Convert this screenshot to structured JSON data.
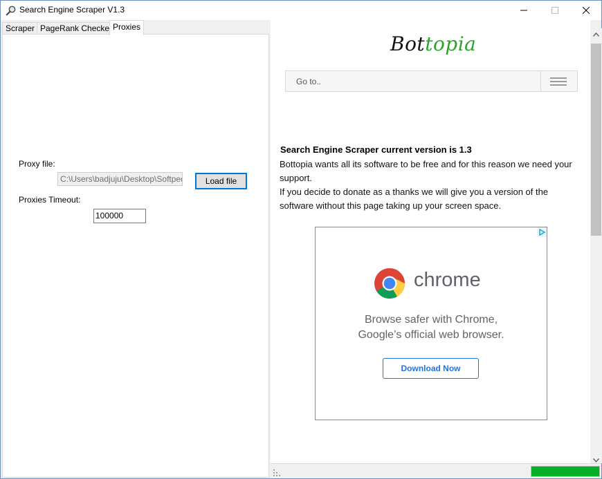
{
  "window": {
    "title": "Search Engine Scraper V1.3",
    "icon": "magnifier-icon"
  },
  "tabs": [
    {
      "label": "Scraper"
    },
    {
      "label": "PageRank Checker"
    },
    {
      "label": "Proxies"
    }
  ],
  "proxies": {
    "proxy_file_label": "Proxy file:",
    "proxy_file_value": "C:\\Users\\badjuju\\Desktop\\Softpedia",
    "load_button_label": "Load file",
    "timeout_label": "Proxies Timeout:",
    "timeout_value": "100000"
  },
  "browser": {
    "logo_part1": "Bot",
    "logo_part2": "topia",
    "goto_label": "Go to..",
    "version_title": "Search Engine Scraper current version is 1.3",
    "text_lines": [
      "Bottopia wants all its software to be free and for this reason we need your",
      "support.",
      "If you decide to donate as a thanks we will give you a version of the",
      "software without this page taking up your screen space."
    ],
    "ad": {
      "brand": "chrome",
      "line1": "Browse safer with Chrome,",
      "line2": "Google’s official web browser.",
      "button": "Download Now"
    }
  },
  "status": {
    "progress_fraction": 1.0
  },
  "colors": {
    "accent": "#0078d7",
    "logo_green": "#2aa52a",
    "progress_green": "#06b025"
  }
}
